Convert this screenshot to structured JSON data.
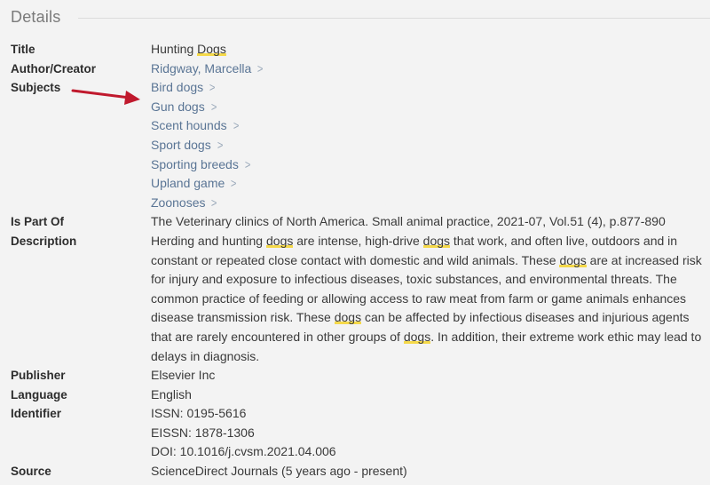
{
  "section": {
    "title": "Details"
  },
  "fields": {
    "title": {
      "label": "Title",
      "value_prefix": "Hunting ",
      "value_highlight": "Dogs"
    },
    "author": {
      "label": "Author/Creator",
      "value": "Ridgway, Marcella",
      "chevron_icon": "chevron-right-icon"
    },
    "subjects": {
      "label": "Subjects",
      "items": [
        {
          "label": "Bird dogs"
        },
        {
          "label": "Gun dogs"
        },
        {
          "label": "Scent hounds"
        },
        {
          "label": "Sport dogs"
        },
        {
          "label": "Sporting breeds"
        },
        {
          "label": "Upland game"
        },
        {
          "label": "Zoonoses"
        }
      ]
    },
    "is_part_of": {
      "label": "Is Part Of",
      "value": "The Veterinary clinics of North America. Small animal practice, 2021-07, Vol.51 (4), p.877-890"
    },
    "description": {
      "label": "Description",
      "segments": [
        {
          "text": "Herding and hunting ",
          "highlight": false
        },
        {
          "text": "dogs",
          "highlight": true
        },
        {
          "text": " are intense, high-drive ",
          "highlight": false
        },
        {
          "text": "dogs",
          "highlight": true
        },
        {
          "text": " that work, and often live, outdoors and in constant or repeated close contact with domestic and wild animals. These ",
          "highlight": false
        },
        {
          "text": "dogs",
          "highlight": true
        },
        {
          "text": " are at increased risk for injury and exposure to infectious diseases, toxic substances, and environmental threats. The common practice of feeding or allowing access to raw meat from farm or game animals enhances disease transmission risk. These ",
          "highlight": false
        },
        {
          "text": "dogs",
          "highlight": true
        },
        {
          "text": " can be affected by infectious diseases and injurious agents that are rarely encountered in other groups of ",
          "highlight": false
        },
        {
          "text": "dogs",
          "highlight": true
        },
        {
          "text": ". In addition, their extreme work ethic may lead to delays in diagnosis.",
          "highlight": false
        }
      ]
    },
    "publisher": {
      "label": "Publisher",
      "value": "Elsevier Inc"
    },
    "language": {
      "label": "Language",
      "value": "English"
    },
    "identifier": {
      "label": "Identifier",
      "lines": [
        "ISSN: 0195-5616",
        "EISSN: 1878-1306",
        "DOI: 10.1016/j.cvsm.2021.04.006"
      ]
    },
    "source": {
      "label": "Source",
      "value": "ScienceDirect Journals (5 years ago - present)"
    }
  },
  "annotation": {
    "arrow_icon": "red-arrow-icon",
    "arrow_color": "#c0192d",
    "points_to": "Subjects"
  },
  "colors": {
    "background": "#f3f3f3",
    "link": "#5a7595",
    "highlight": "#f5d94a",
    "label": "#2d2d2d",
    "text": "#3a3a3a"
  }
}
